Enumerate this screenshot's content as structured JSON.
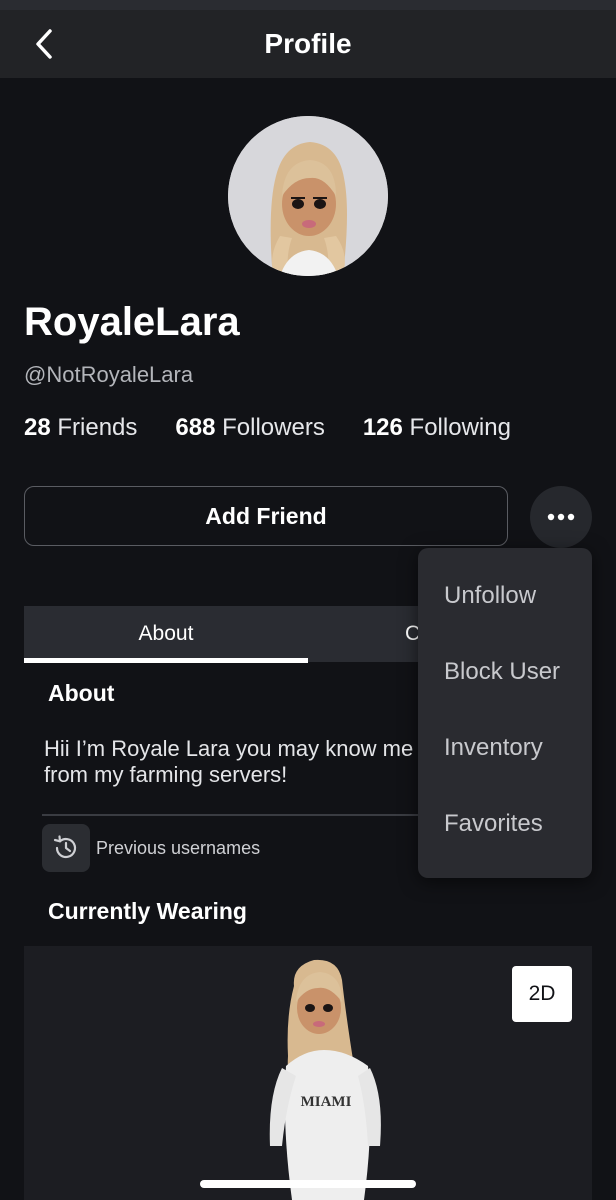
{
  "header": {
    "title": "Profile",
    "back_icon": "chevron-left-icon"
  },
  "profile": {
    "display_name": "RoyaleLara",
    "username": "@NotRoyaleLara",
    "stats": [
      {
        "count": "28",
        "label": "Friends"
      },
      {
        "count": "688",
        "label": "Followers"
      },
      {
        "count": "126",
        "label": "Following"
      }
    ]
  },
  "actions": {
    "add_friend_label": "Add Friend",
    "more_icon": "more-horizontal-icon"
  },
  "menu": {
    "items": [
      "Unfollow",
      "Block User",
      "Inventory",
      "Favorites"
    ]
  },
  "tabs": {
    "about": "About",
    "creations": "Creations"
  },
  "about": {
    "heading": "About",
    "text": "Hii I’m Royale Lara you may know me from my farming servers!",
    "previous_usernames_label": "Previous usernames",
    "history_icon": "history-icon"
  },
  "wearing": {
    "heading": "Currently Wearing",
    "toggle_2d_label": "2D",
    "shirt_text": "MIAMI"
  },
  "colors": {
    "background": "#111216",
    "header": "#222326",
    "menu": "#2a2b30",
    "accent": "#ffffff"
  }
}
